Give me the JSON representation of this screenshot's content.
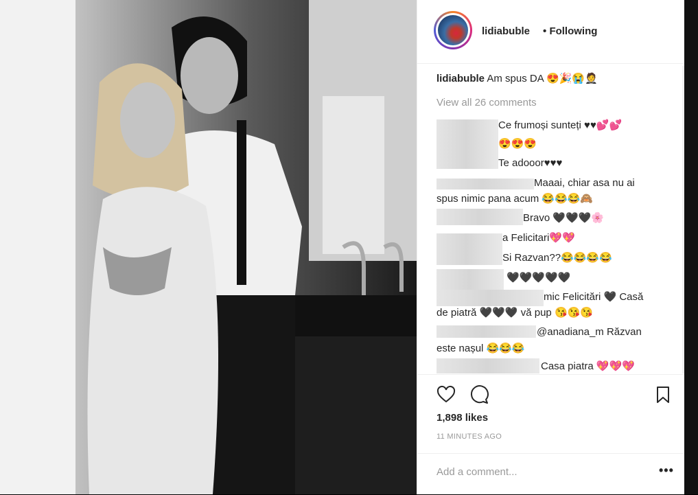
{
  "post": {
    "username": "lidiabuble",
    "separator": "•",
    "follow_status": "Following",
    "caption_user": "lidiabuble",
    "caption_text": "Am spus DA 😍🎉😭🤵",
    "view_all": "View all 26 comments"
  },
  "comments": [
    {
      "text": "Ce frumoși sunteți ♥♥💕💕"
    },
    {
      "text": "😍😍😍"
    },
    {
      "text": "Te adooor♥♥♥"
    },
    {
      "text": "Maaai, chiar asa nu ai"
    },
    {
      "text": "spus nimic pana acum 😂😂😂🙈"
    },
    {
      "text": "Bravo 🖤🖤🖤🌸"
    },
    {
      "text": "a Felicitari💖💖"
    },
    {
      "text": "Si Razvan??😂😂😂😂"
    },
    {
      "text": "🖤🖤🖤🖤🖤"
    },
    {
      "text": "mic Felicitări 🖤 Casă"
    },
    {
      "text": "de piatră 🖤🖤🖤 vă pup 😘😘😘"
    },
    {
      "text": "@anadiana_m Răzvan"
    },
    {
      "text": "este nașul 😂😂😂"
    },
    {
      "text": "Casa piatra 💖💖💖"
    }
  ],
  "stats": {
    "likes": "1,898 likes",
    "time": "11 MINUTES AGO"
  },
  "add_comment": {
    "placeholder": "Add a comment...",
    "more": "•••"
  },
  "icons": {
    "like": "heart-icon",
    "comment": "comment-icon",
    "save": "bookmark-icon",
    "more": "more-options-icon"
  },
  "colors": {
    "text": "#262626",
    "secondary": "#999999",
    "border": "#efefef"
  }
}
